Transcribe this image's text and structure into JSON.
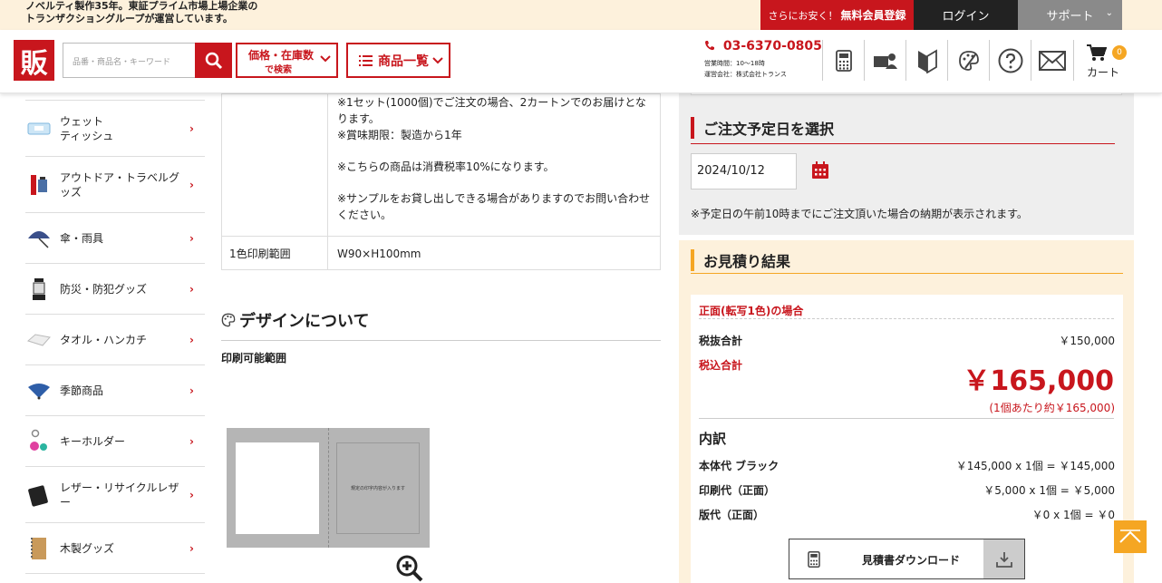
{
  "topbar": {
    "tagline_1": "ノベルティ製作35年。東証プライム市場上場企業の",
    "tagline_2": "トランザクショングループが運営しています。",
    "register_small": "さらにお安く！",
    "register_bold": "無料会員登録",
    "login": "ログイン",
    "support": "サポート"
  },
  "header": {
    "logo": "販",
    "search_placeholder": "品番・商品名・キーワード",
    "price_line1": "価格・在庫数",
    "price_line2": "で検索",
    "product_list": "商品一覧",
    "phone": "03-6370-0805",
    "hours": "営業時間：10〜18時",
    "company": "運営会社：株式会社トランス",
    "cart_label": "カート",
    "cart_count": "0"
  },
  "sidebar": {
    "items": [
      {
        "label": "ウェット\nティッシュ",
        "icon": "wet-tissue-icon"
      },
      {
        "label": "アウトドア・トラベルグッズ",
        "icon": "outdoor-travel-icon"
      },
      {
        "label": "傘・雨具",
        "icon": "umbrella-icon"
      },
      {
        "label": "防災・防犯グッズ",
        "icon": "lantern-icon"
      },
      {
        "label": "タオル・ハンカチ",
        "icon": "towel-icon"
      },
      {
        "label": "季節商品",
        "icon": "fan-icon"
      },
      {
        "label": "キーホルダー",
        "icon": "keychain-icon"
      },
      {
        "label": "レザー・リサイクルレザー",
        "icon": "leather-icon"
      },
      {
        "label": "木製グッズ",
        "icon": "wooden-notebook-icon"
      }
    ]
  },
  "spec": {
    "notes": [
      "※1セット(1000個)でご注文の場合、2カートンでのお届けとなります。",
      "※賞味期限：製造から1年",
      "",
      "※こちらの商品は消費税率10%になります。",
      "",
      "※サンプルをお貸し出しできる場合がありますのでお問い合わせください。"
    ],
    "print_range_label": "1色印刷範囲",
    "print_range_value": "W90×H100mm"
  },
  "design": {
    "title": "デザインについて",
    "print_area": "印刷可能範囲",
    "preview_text": "規定の印字内容が入ります"
  },
  "order_date": {
    "title": "ご注文予定日を選択",
    "date": "2024/10/12",
    "note": "※予定日の午前10時までにご注文頂いた場合の納期が表示されます。"
  },
  "estimate": {
    "title": "お見積り結果",
    "case": "正面(転写1色)の場合",
    "subtotal_label": "税抜合計",
    "subtotal_value": "￥150,000",
    "total_label": "税込合計",
    "total_value": "￥165,000",
    "per_unit": "(1個あたり約￥165,000)",
    "breakdown_title": "内訳",
    "breakdown": [
      {
        "label": "本体代 ブラック",
        "value": "￥145,000 x 1個 = ￥145,000"
      },
      {
        "label": "印刷代（正面）",
        "value": "￥5,000 x 1個 = ￥5,000"
      },
      {
        "label": "版代（正面）",
        "value": "￥0 x 1個 = ￥0"
      }
    ],
    "download": "見積書ダウンロード"
  },
  "colors": {
    "brand_red": "#c8161d",
    "accent_orange": "#f5a623",
    "cream": "#fdf1dc"
  }
}
